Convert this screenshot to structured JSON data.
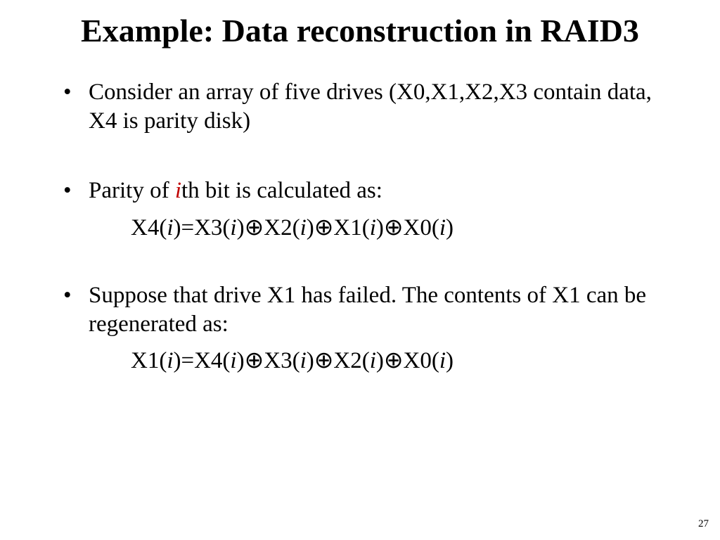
{
  "title": "Example: Data reconstruction in RAID3",
  "bullets": {
    "b1": "Consider an array of five drives (X0,X1,X2,X3 contain data, X4 is parity disk)",
    "b2_pre": "Parity of ",
    "b2_i": "i",
    "b2_post": "th bit is calculated as:",
    "b3": "Suppose that drive X1 has failed. The contents of X1 can be regenerated as:"
  },
  "formula1": {
    "p1": "X4(",
    "i1": "i",
    "p2": ")=X3(",
    "i2": "i",
    "p3": ")⊕X2(",
    "i3": "i",
    "p4": ")⊕X1(",
    "i4": "i",
    "p5": ")⊕X0(",
    "i5": "i",
    "p6": ")"
  },
  "formula2": {
    "p1": "X1(",
    "i1": "i",
    "p2": ")=X4(",
    "i2": "i",
    "p3": ")⊕X3(",
    "i3": "i",
    "p4": ")⊕X2(",
    "i4": "i",
    "p5": ")⊕X0(",
    "i5": "i",
    "p6": ")"
  },
  "page_number": "27"
}
